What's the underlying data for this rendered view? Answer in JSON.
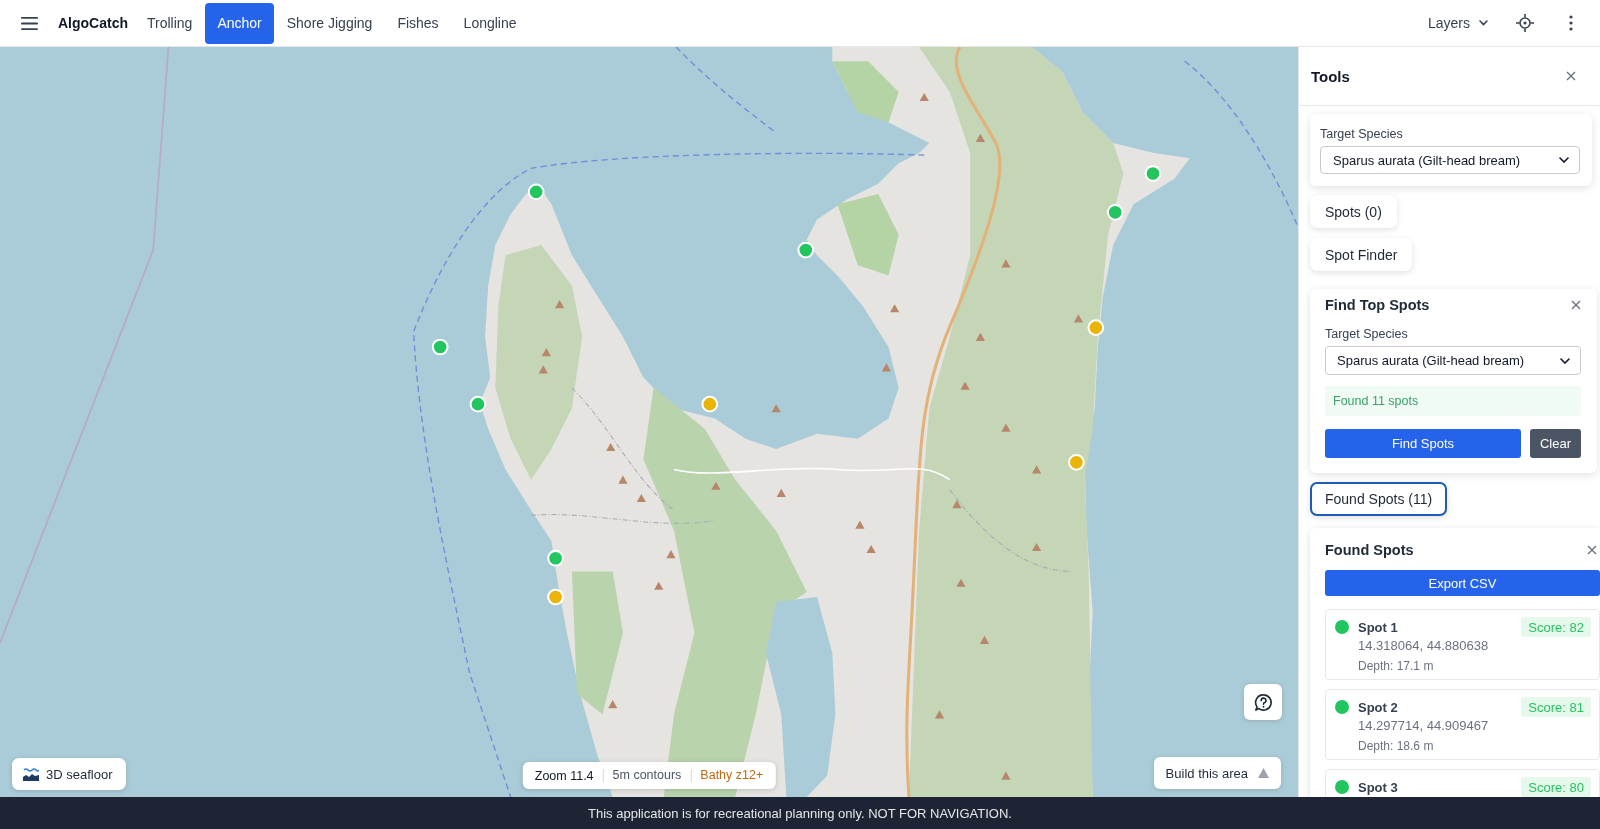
{
  "topbar": {
    "brand": "AlgoCatch",
    "tabs": [
      {
        "label": "Trolling",
        "selected": false
      },
      {
        "label": "Anchor",
        "selected": true
      },
      {
        "label": "Shore Jigging",
        "selected": false
      },
      {
        "label": "Fishes",
        "selected": false
      },
      {
        "label": "Longline",
        "selected": false
      }
    ],
    "layers": "Layers"
  },
  "map": {
    "markers": [
      {
        "color": "#22c55e"
      },
      {
        "color": "#22c55e"
      },
      {
        "color": "#22c55e"
      },
      {
        "color": "#22c55e"
      },
      {
        "color": "#eab308"
      },
      {
        "color": "#22c55e"
      },
      {
        "color": "#22c55e"
      },
      {
        "color": "#eab308"
      },
      {
        "color": "#eab308"
      },
      {
        "color": "#22c55e"
      },
      {
        "color": "#eab308"
      }
    ],
    "seafloor_button": "3D seafloor",
    "status": {
      "zoom": "Zoom 11.4",
      "contours": "5m contours",
      "bathy": "Bathy z12+"
    },
    "build_button": "Build this area"
  },
  "panel": {
    "title": "Tools",
    "species_card": {
      "label": "Target Species",
      "value": "Sparus aurata (Gilt-head bream)"
    },
    "toggles": [
      {
        "label": "Spots (0)",
        "focused": false
      },
      {
        "label": "Spot Finder",
        "focused": false
      }
    ],
    "finder": {
      "title": "Find Top Spots",
      "label": "Target Species",
      "value": "Sparus aurata (Gilt-head bream)",
      "status": "Found 11 spots",
      "buttons": [
        {
          "label": "Find Spots",
          "kind": "primary"
        },
        {
          "label": "Clear",
          "kind": "secondary"
        }
      ]
    },
    "found_toggle": {
      "label": "Found Spots (11)",
      "focused": true
    },
    "found": {
      "title": "Found Spots",
      "export": "Export CSV",
      "spots": [
        {
          "name": "Spot 1",
          "score": "Score: 82",
          "coords": "14.318064, 44.880638",
          "depth": "Depth: 17.1 m",
          "color": "#22c55e"
        },
        {
          "name": "Spot 2",
          "score": "Score: 81",
          "coords": "14.297714, 44.909467",
          "depth": "Depth: 18.6 m",
          "color": "#22c55e"
        },
        {
          "name": "Spot 3",
          "score": "Score: 80",
          "color": "#22c55e"
        }
      ]
    }
  },
  "banner": "This application is for recreational planning only. NOT FOR NAVIGATION."
}
